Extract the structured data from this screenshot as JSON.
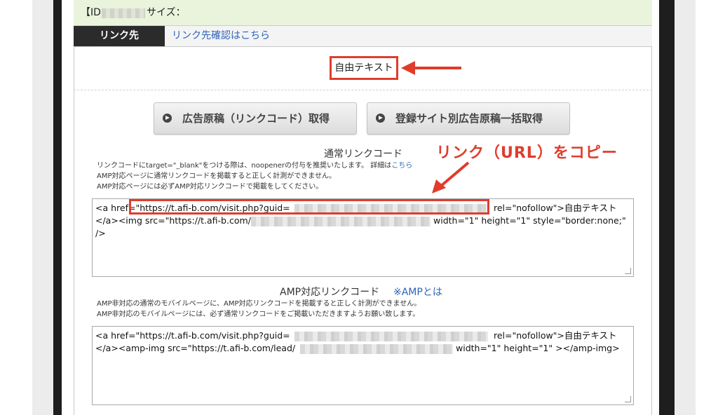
{
  "header": {
    "id_label": "【ID:",
    "size_label": "サイズ："
  },
  "link_row": {
    "head": "リンク先",
    "confirm_link": "リンク先確認はこちら"
  },
  "free_text_label": "自由テキスト",
  "buttons": {
    "get_ad": "広告原稿（リンクコード）取得",
    "bulk_get": "登録サイト別広告原稿一括取得"
  },
  "normal": {
    "title": "通常リンクコード",
    "note1_prefix": "リンクコードにtarget=\"_blank\"をつける際は、noopenerの付与を推奨いたします。 詳細は",
    "note1_link": "こちら",
    "note2": "AMP対応ページに通常リンクコードを掲載すると正しく計測ができません。",
    "note3": "AMP対応ページには必ずAMP対応リンクコードで掲載をしてください。",
    "code_line1_a": "<a href=\"https://t.afi-b.com/visit.php?guid=",
    "code_line1_b": "rel=\"nofollow\">自由テキスト",
    "code_line2_a": "</a><img src=\"https://t.afi-b.com/",
    "code_line2_b": "width=\"1\" height=\"1\" style=\"border:none;\"",
    "code_line3": "/>"
  },
  "callout": "リンク（URL）をコピー",
  "amp": {
    "title": "AMP対応リンクコード",
    "about_link": "※AMPとは",
    "note1": "AMP非対応の通常のモバイルページに、AMP対応リンクコードを掲載すると正しく計測ができません。",
    "note2": "AMP非対応のモバイルページには、必ず通常リンクコードをご掲載いただきますようお願い致します。",
    "code_line1_a": "<a href=\"https://t.afi-b.com/visit.php?guid=",
    "code_line1_b": "rel=\"nofollow\">自由テキスト",
    "code_line2_a": "</a><amp-img src=\"https://t.afi-b.com/lead/",
    "code_line2_b": "width=\"1\" height=\"1\" ></amp-img>"
  },
  "colors": {
    "accent_red": "#e03c2c",
    "link_blue": "#2e63b8",
    "id_row_bg": "#eaf3dc"
  }
}
